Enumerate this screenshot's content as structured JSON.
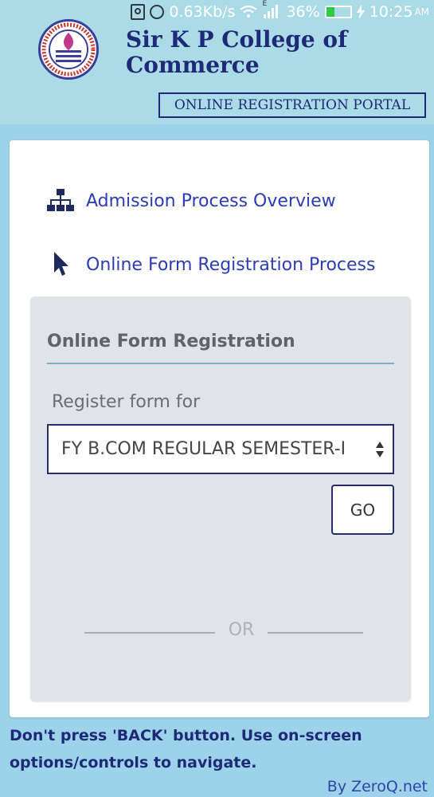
{
  "status_bar": {
    "speed": "0.63Kb/s",
    "signal_indicator": "E",
    "battery_percent": "36%",
    "battery_level": 0.36,
    "time": "10:25",
    "ampm": "AM"
  },
  "header": {
    "college_name_line1": "Sir K P College of",
    "college_name_line2": "Commerce",
    "portal_label": "ONLINE REGISTRATION PORTAL"
  },
  "nav": {
    "items": [
      {
        "label": "Admission Process Overview",
        "icon": "sitemap-icon"
      },
      {
        "label": "Online Form Registration Process",
        "icon": "pointer-icon"
      }
    ]
  },
  "form": {
    "title": "Online Form Registration",
    "register_label": "Register form for",
    "selected_course": "FY B.COM REGULAR SEMESTER-I",
    "go_label": "GO",
    "or_label": "OR"
  },
  "footer": {
    "warning": "Don't press 'BACK' button. Use on-screen options/controls to navigate.",
    "credit": "By ZeroQ.net"
  },
  "colors": {
    "page_background": "#9dd3ea",
    "header_background": "#aadbe6",
    "brand_navy": "#1e2a78",
    "link_blue": "#2b3cb5",
    "panel_gray": "#dfe4e8"
  }
}
